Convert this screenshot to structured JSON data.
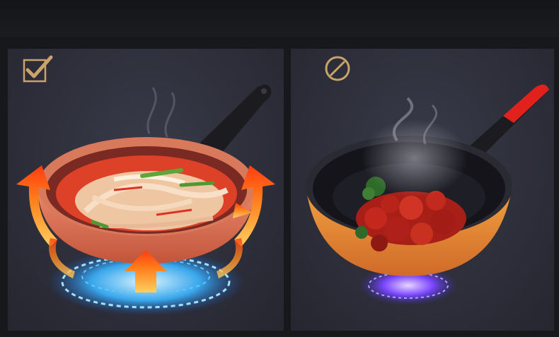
{
  "page": {
    "background_color": "#17181c",
    "panel_color": "#30313d"
  },
  "left_panel": {
    "badge_icon": "checkmark-box-icon",
    "badge_color": "#c9a46a",
    "subject": "pan-with-food-over-flame-icon",
    "heat_arrow_color": "#ff5a12"
  },
  "right_panel": {
    "badge_icon": "prohibited-circle-icon",
    "badge_color": "#c9a46a",
    "subject": "wok-with-meat-over-flame-icon",
    "handle_accent_color": "#e0211c"
  }
}
